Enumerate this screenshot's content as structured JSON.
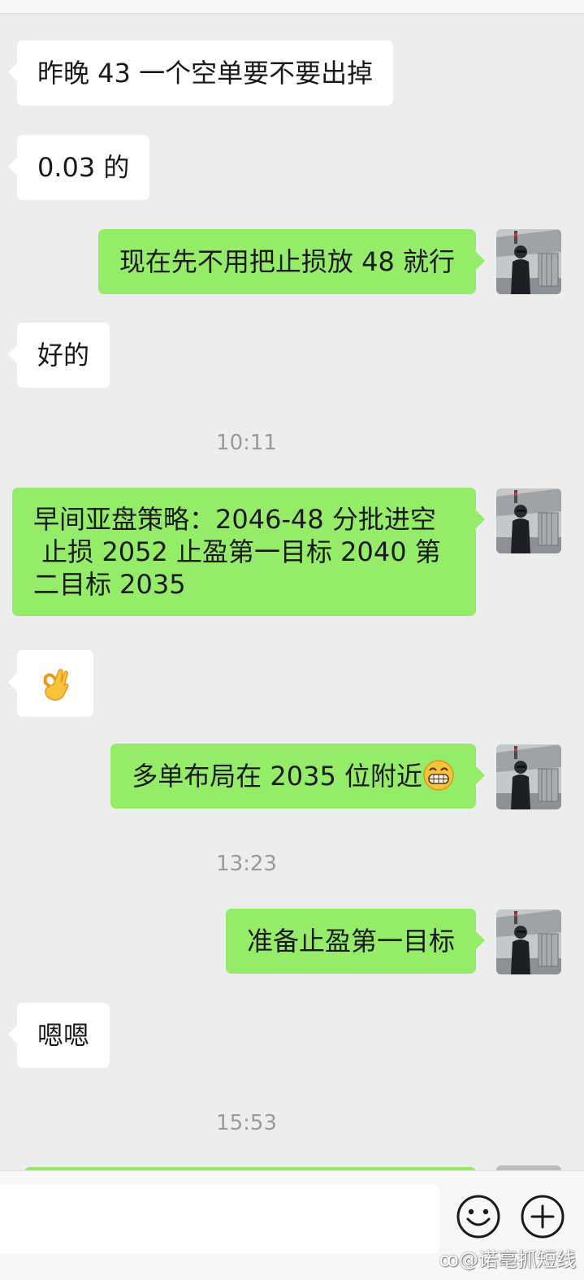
{
  "messages": [
    {
      "dir": "in",
      "text": "昨晚 43 一个空单要不要出掉"
    },
    {
      "dir": "in",
      "text": "0.03 的"
    },
    {
      "dir": "out",
      "text": "现在先不用把止损放 48 就行"
    },
    {
      "dir": "in",
      "text": "好的"
    },
    {
      "time": "10:11"
    },
    {
      "dir": "out",
      "lines": [
        "早间亚盘策略：2046-48 分批进空",
        " 止损 2052 止盈第一目标 2040 第",
        "二目标 2035"
      ]
    },
    {
      "dir": "in",
      "emoji": "ok-hand-emoji"
    },
    {
      "dir": "out",
      "text": "多单布局在 2035 位附近",
      "emoji": "grinning-face-emoji"
    },
    {
      "time": "13:23"
    },
    {
      "dir": "out",
      "text": "准备止盈第一目标"
    },
    {
      "dir": "in",
      "text": "嗯嗯"
    },
    {
      "time": "15:53"
    }
  ],
  "watermark": "@诺亳抓短线",
  "colors": {
    "chat_bg": "#ededed",
    "incoming_bubble": "#ffffff",
    "outgoing_bubble": "#95ec69",
    "timestamp_text": "#9a9a9a"
  }
}
